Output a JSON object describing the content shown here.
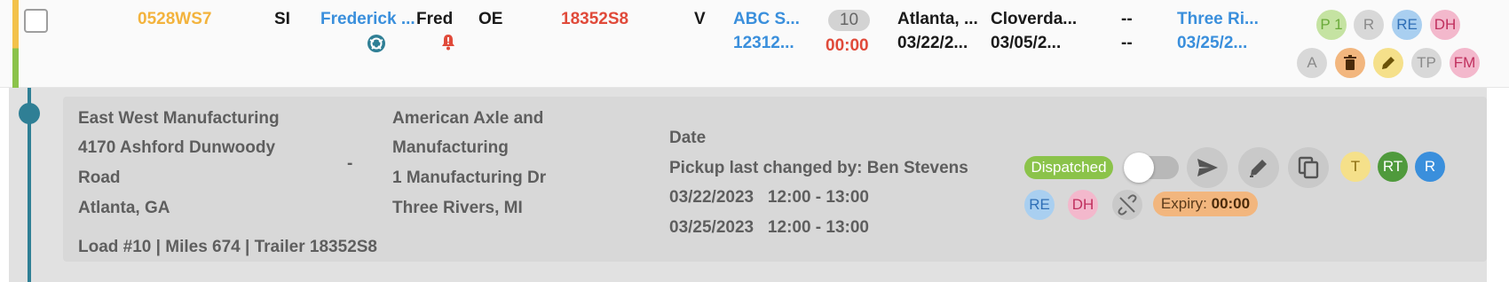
{
  "row": {
    "load_id": "0528WS7",
    "code": "SI",
    "customer_rep": "Frederick ...",
    "dispatcher": "Fred",
    "type": "OE",
    "trailer": "18352S8",
    "mode": "V",
    "shipper_name": "ABC S...",
    "shipper_ref": "12312...",
    "count": "10",
    "timer": "00:00",
    "origin_city": "Atlanta, ...",
    "origin_date": "03/22/2...",
    "dest_city": "Cloverda...",
    "dest_date": "03/05/2...",
    "dash1": "--",
    "dash2": "--",
    "final_city": "Three Ri...",
    "final_date": "03/25/2...",
    "badges_top": [
      "P 1",
      "R",
      "RE",
      "DH"
    ],
    "badges_bottom": [
      "A",
      "TP",
      "FM"
    ]
  },
  "detail": {
    "origin": {
      "company": "East West Manufacturing",
      "address1": "4170 Ashford Dunwoody",
      "address2": "Road",
      "city": "Atlanta, GA"
    },
    "separator": "-",
    "destination": {
      "company1": "American Axle and",
      "company2": "Manufacturing",
      "address": "1 Manufacturing Dr",
      "city": "Three Rivers, MI"
    },
    "summary": "Load #10 | Miles 674 | Trailer 18352S8",
    "date_label": "Date",
    "changed_by": "Pickup last changed by: Ben Stevens",
    "pickup_window": "03/22/2023   12:00 - 13:00",
    "delivery_window": "03/25/2023   12:00 - 13:00",
    "status": "Dispatched",
    "badges_right": [
      "T",
      "RT",
      "R"
    ],
    "badges_small": [
      "RE",
      "DH"
    ],
    "expiry_label": "Expiry:",
    "expiry_value": "00:00"
  },
  "icons": [
    "checkbox",
    "support-icon",
    "alarm-bell-icon",
    "trash-icon",
    "pencil-icon",
    "send-icon",
    "edit-icon",
    "copy-icon",
    "unlink-icon"
  ],
  "colors": {
    "accent_orange": "#f3b33d",
    "link_blue": "#3a8fdc",
    "alert_red": "#e04a3a",
    "timeline_teal": "#2f7f95",
    "dispatched_green": "#8bc34a"
  }
}
